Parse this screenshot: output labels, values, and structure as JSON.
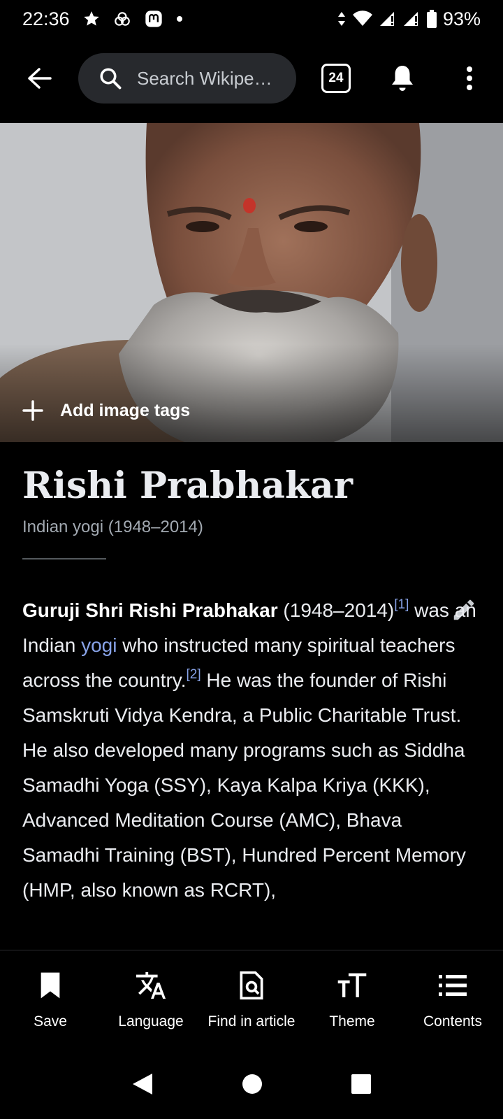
{
  "status_bar": {
    "time": "22:36",
    "battery": "93%"
  },
  "toolbar": {
    "search_placeholder": "Search Wikipe…",
    "tab_count": "24"
  },
  "hero": {
    "add_tags_label": "Add image tags"
  },
  "article": {
    "title": "Rishi Prabhakar",
    "description": "Indian yogi (1948–2014)",
    "bold_name": "Guruji Shri Rishi Prabhakar",
    "text_1": " (1948–2014)",
    "ref_1": "[1]",
    "text_2": " was an Indian ",
    "link_yogi": "yogi",
    "text_3": " who instructed many spiritual teachers across the country.",
    "ref_2": "[2]",
    "text_4": " He was the founder of Rishi Samskruti Vidya Kendra, a Public Charitable Trust. He also developed many programs such as Siddha Samadhi Yoga (SSY), Kaya Kalpa Kriya (KKK), Advanced Meditation Course (AMC), Bhava Samadhi Training (BST), Hundred Percent Memory (HMP, also known as RCRT),"
  },
  "actions": {
    "save": "Save",
    "language": "Language",
    "find": "Find in article",
    "theme": "Theme",
    "contents": "Contents"
  },
  "colors": {
    "link": "#88a3e8",
    "background": "#000000",
    "search_bg": "#27292d"
  }
}
